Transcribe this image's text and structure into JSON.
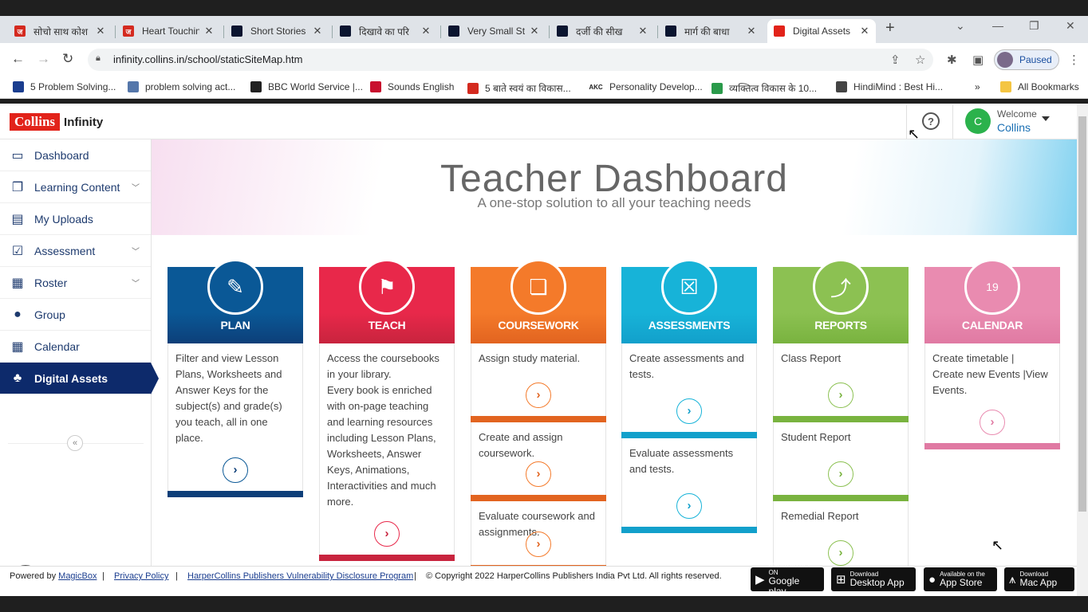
{
  "browser": {
    "tabs": [
      {
        "title": "सोचो साथ कोश",
        "fav": "ज",
        "color": "#d42a1f"
      },
      {
        "title": "Heart Touching",
        "fav": "ज",
        "color": "#d42a1f"
      },
      {
        "title": "Short Stories",
        "fav": "",
        "color": "#0b1530"
      },
      {
        "title": "दिखावे का परि",
        "fav": "",
        "color": "#0b1530"
      },
      {
        "title": "Very Small St",
        "fav": "",
        "color": "#0b1530"
      },
      {
        "title": "दर्जी की सीख",
        "fav": "",
        "color": "#0b1530"
      },
      {
        "title": "मार्ग की बाधा",
        "fav": "",
        "color": "#0b1530"
      },
      {
        "title": "Digital Assets",
        "fav": "",
        "color": "#e2231a"
      }
    ],
    "url": "infinity.collins.in/school/staticSiteMap.htm",
    "profile_label": "Paused",
    "bookmarks": [
      {
        "label": "5 Problem Solving...",
        "color": "#1a3d8f"
      },
      {
        "label": "problem solving act...",
        "color": "#5577aa"
      },
      {
        "label": "BBC World Service |...",
        "color": "#222"
      },
      {
        "label": "Sounds English",
        "color": "#c8102e"
      },
      {
        "label": "5 बाते स्वयं का विकास...",
        "color": "#d42a1f"
      },
      {
        "label": "Personality Develop...",
        "color": "#222"
      },
      {
        "label": "व्यक्तित्व विकास के 10...",
        "color": "#2a9a4a"
      },
      {
        "label": "HindiMind : Best Hi...",
        "color": "#444"
      }
    ],
    "bookmarks_more": "»",
    "all_bookmarks": "All Bookmarks",
    "akc": "AKC"
  },
  "header": {
    "logo_main": "Collins",
    "logo_sub": "Infinity",
    "help": "?",
    "avatar_letter": "C",
    "welcome": "Welcome",
    "user": "Collins"
  },
  "sidebar": {
    "items": [
      {
        "label": "Dashboard",
        "icon": "▭"
      },
      {
        "label": "Learning Content",
        "icon": "❐"
      },
      {
        "label": "My Uploads",
        "icon": "▤"
      },
      {
        "label": "Assessment",
        "icon": "☑"
      },
      {
        "label": "Roster",
        "icon": "▦"
      },
      {
        "label": "Group",
        "icon": "●"
      },
      {
        "label": "Calendar",
        "icon": "▦"
      },
      {
        "label": "Digital Assets",
        "icon": "♣"
      }
    ],
    "collapse": "«"
  },
  "banner": {
    "title": "Teacher Dashboard",
    "subtitle": "A one-stop solution to all your teaching needs"
  },
  "cards": [
    {
      "label": "PLAN",
      "icon": "✎",
      "color": "#0a5896",
      "dark": "#0d3f79",
      "bar": "#0d3f79",
      "sections": [
        {
          "text": "Filter and view Lesson Plans, Worksheets and Answer Keys for the subject(s) and grade(s) you teach, all in one place."
        }
      ]
    },
    {
      "label": "TEACH",
      "icon": "⚑",
      "color": "#e8284a",
      "dark": "#c8243e",
      "bar": "#c8243e",
      "sections": [
        {
          "text": "Access the coursebooks in your library.\nEvery book is enriched with on-page teaching and learning resources including Lesson Plans, Worksheets, Answer Keys, Animations, Interactivities and much more."
        }
      ]
    },
    {
      "label": "COURSEWORK",
      "icon": "❏",
      "color": "#f47a2a",
      "dark": "#e26420",
      "bar": "#e26420",
      "sections": [
        {
          "text": "Assign study material."
        },
        {
          "text": "Create and assign coursework."
        },
        {
          "text": "Evaluate coursework and assignments."
        }
      ]
    },
    {
      "label": "ASSESSMENTS",
      "icon": "☒",
      "color": "#17b3d8",
      "dark": "#12a0cb",
      "bar": "#12a0cb",
      "sections": [
        {
          "text": "Create assessments and tests."
        },
        {
          "text": "Evaluate assessments and tests."
        }
      ]
    },
    {
      "label": "REPORTS",
      "icon": "⤴",
      "color": "#8cc152",
      "dark": "#79b33f",
      "bar": "#79b33f",
      "sections": [
        {
          "text": "Class Report"
        },
        {
          "text": "Student Report"
        },
        {
          "text": "Remedial Report"
        }
      ]
    },
    {
      "label": "CALENDAR",
      "icon": "19",
      "color": "#e98bb0",
      "dark": "#e07aa3",
      "bar": "#e07aa3",
      "sections": [
        {
          "text": "Create timetable |\nCreate new Events |View Events."
        }
      ]
    }
  ],
  "footer": {
    "powered": "Powered by",
    "magicbox": "MagicBox",
    "sep": "|",
    "privacy": "Privacy Policy",
    "vuln": "HarperCollins Publishers Vulnerability Disclosure Program",
    "copyright": "© Copyright 2022 HarperCollins Publishers India Pvt Ltd. All rights reserved.",
    "stores": [
      {
        "small": "ANDROID APP ON",
        "big": "Google play",
        "glyph": "▶"
      },
      {
        "small": "Download",
        "big": "Desktop App",
        "glyph": "⊞"
      },
      {
        "small": "Available on the",
        "big": "App Store",
        "glyph": "●"
      },
      {
        "small": "Download",
        "big": "Mac App",
        "glyph": "⩚"
      }
    ]
  }
}
